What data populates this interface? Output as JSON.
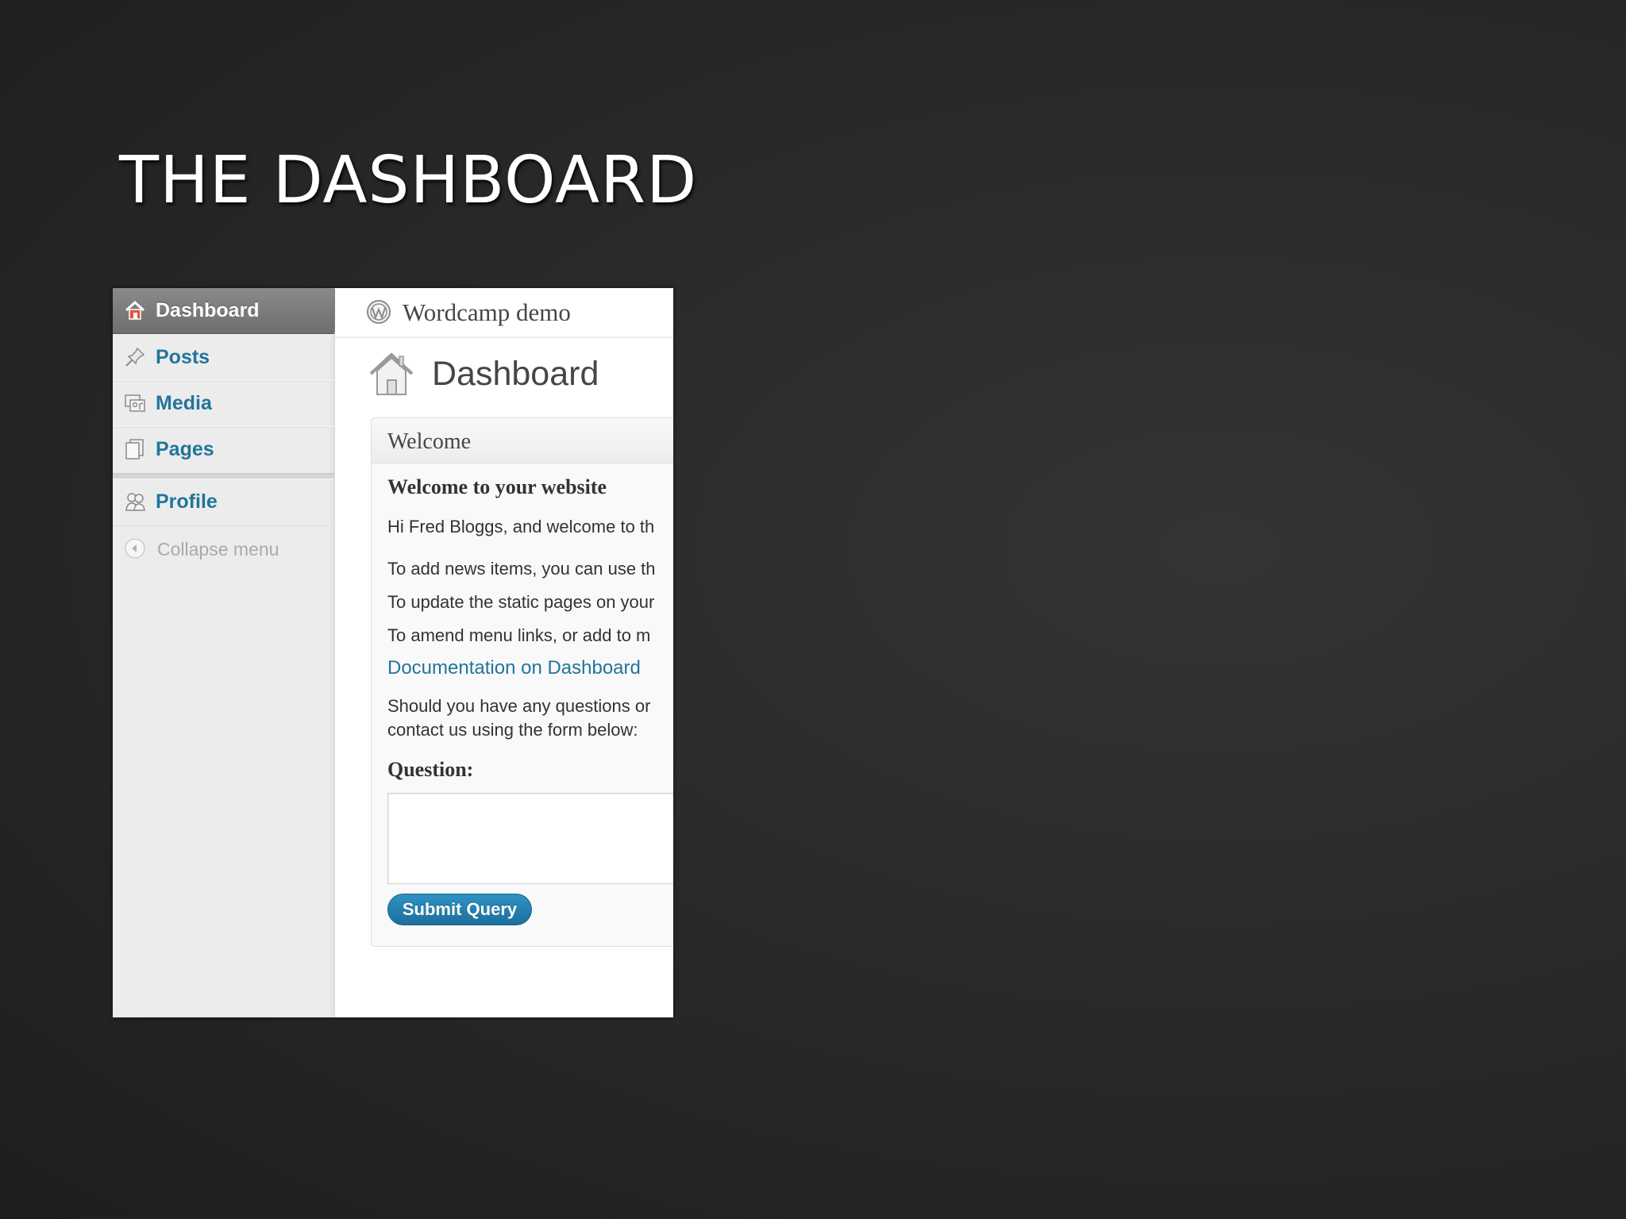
{
  "slide": {
    "title": "THE DASHBOARD"
  },
  "sidebar": {
    "current_item": {
      "label": "Dashboard",
      "icon": "home-icon"
    },
    "items": [
      {
        "label": "Posts",
        "icon": "pin-icon"
      },
      {
        "label": "Media",
        "icon": "media-icon"
      },
      {
        "label": "Pages",
        "icon": "pages-icon"
      },
      {
        "label": "Profile",
        "icon": "users-icon"
      }
    ],
    "collapse_label": "Collapse menu"
  },
  "header": {
    "site_name": "Wordcamp demo"
  },
  "main": {
    "page_title": "Dashboard",
    "welcome_box": {
      "title": "Welcome",
      "heading": "Welcome to your website",
      "lines": [
        "Hi Fred Bloggs, and welcome to th",
        "To add news items, you can use th",
        "To update the static pages on your",
        "To amend menu links, or add to m"
      ],
      "doc_link": "Documentation on Dashboard",
      "questions_line1": "Should you have any questions or",
      "questions_line2": "contact us using the form below:",
      "question_label": "Question:",
      "submit_label": "Submit Query"
    }
  },
  "colors": {
    "link": "#21759b",
    "button": "#21759b",
    "current_menu": "#777777",
    "sidebar_bg": "#ececec"
  }
}
